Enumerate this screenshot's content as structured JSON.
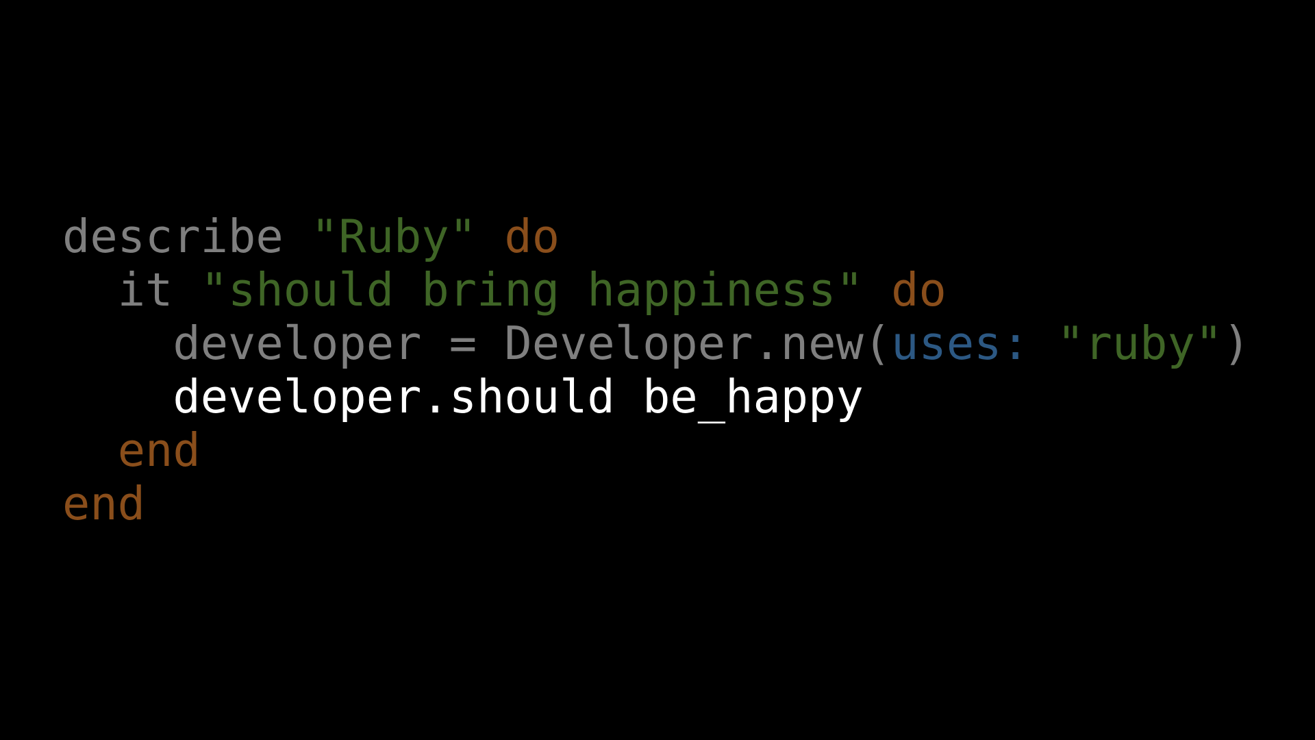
{
  "colors": {
    "background": "#000000",
    "plain": "#7f7f7f",
    "string": "#3f6526",
    "keyword": "#8a4e1b",
    "symbol": "#2c5883",
    "focus": "#ffffff"
  },
  "code": {
    "language": "ruby",
    "lines": [
      {
        "indent": "",
        "tokens": [
          {
            "text": "describe ",
            "type": "plain"
          },
          {
            "text": "\"Ruby\"",
            "type": "string"
          },
          {
            "text": " ",
            "type": "plain"
          },
          {
            "text": "do",
            "type": "keyword"
          }
        ]
      },
      {
        "indent": "  ",
        "tokens": [
          {
            "text": "it ",
            "type": "plain"
          },
          {
            "text": "\"should bring happiness\"",
            "type": "string"
          },
          {
            "text": " ",
            "type": "plain"
          },
          {
            "text": "do",
            "type": "keyword"
          }
        ]
      },
      {
        "indent": "    ",
        "tokens": [
          {
            "text": "developer = Developer.new(",
            "type": "plain"
          },
          {
            "text": "uses:",
            "type": "symbol"
          },
          {
            "text": " ",
            "type": "plain"
          },
          {
            "text": "\"ruby\"",
            "type": "string"
          },
          {
            "text": ")",
            "type": "plain"
          }
        ]
      },
      {
        "indent": "    ",
        "tokens": [
          {
            "text": "developer.should be_happy",
            "type": "focus"
          }
        ]
      },
      {
        "indent": "  ",
        "tokens": [
          {
            "text": "end",
            "type": "keyword"
          }
        ]
      },
      {
        "indent": "",
        "tokens": [
          {
            "text": "end",
            "type": "keyword"
          }
        ]
      }
    ]
  }
}
